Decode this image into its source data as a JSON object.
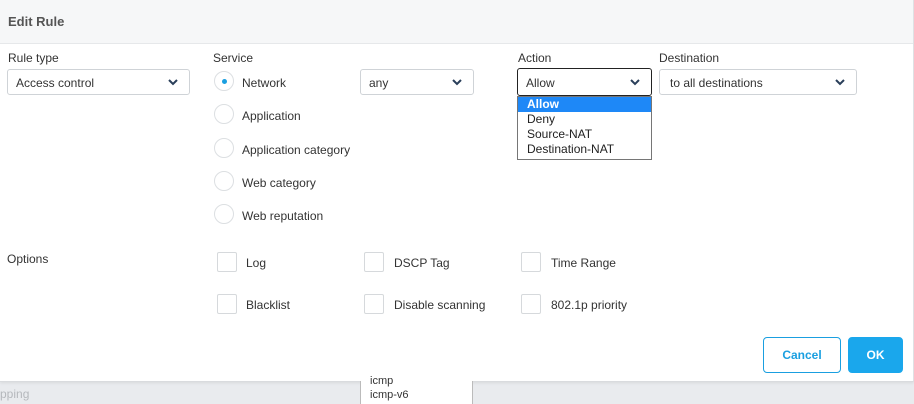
{
  "background": {
    "text": "pping"
  },
  "dialog": {
    "title": "Edit Rule",
    "rule_type": {
      "label": "Rule type",
      "value": "Access control"
    },
    "service": {
      "label": "Service",
      "options": [
        "Network",
        "Application",
        "Application category",
        "Web category",
        "Web reputation"
      ],
      "selected": "Network",
      "network_value": "any"
    },
    "action": {
      "label": "Action",
      "value": "Allow",
      "dropdown_options": [
        "Allow",
        "Deny",
        "Source-NAT",
        "Destination-NAT"
      ]
    },
    "destination": {
      "label": "Destination",
      "value": "to all destinations"
    },
    "options": {
      "label": "Options",
      "checkboxes": [
        "Log",
        "DSCP Tag",
        "Time Range",
        "Blacklist",
        "Disable scanning",
        "802.1p priority"
      ]
    },
    "buttons": {
      "cancel": "Cancel",
      "ok": "OK"
    }
  },
  "service_list_overflow": [
    "icmp",
    "icmp-v6"
  ],
  "colors": {
    "accent": "#1a9fe0",
    "selected_option": "#1e88f7"
  },
  "icons": {
    "chevron": "chevron-down-icon"
  }
}
